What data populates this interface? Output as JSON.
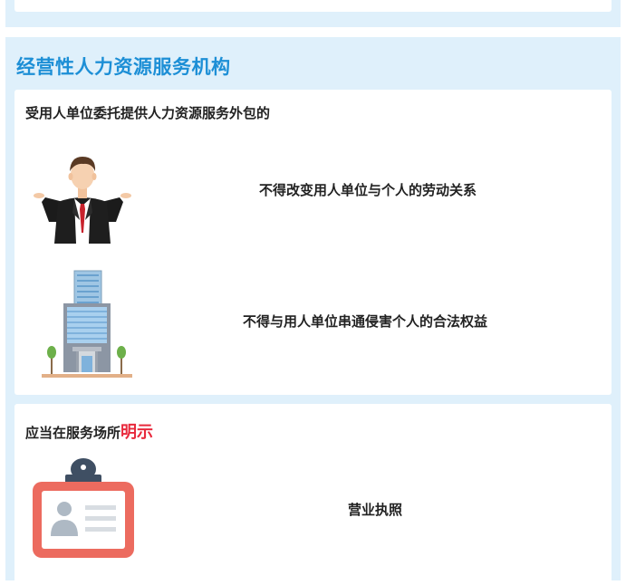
{
  "section": {
    "title": "经营性人力资源服务机构"
  },
  "card1": {
    "heading": "受用人单位委托提供人力资源服务外包的",
    "rows": [
      {
        "icon": "businessman-icon",
        "text": "不得改变用人单位与个人的劳动关系"
      },
      {
        "icon": "office-building-icon",
        "text": "不得与用人单位串通侵害个人的合法权益"
      }
    ]
  },
  "card2": {
    "heading_prefix": "应当在服务场所",
    "heading_highlight": "明示",
    "rows": [
      {
        "icon": "id-badge-icon",
        "text": "营业执照"
      }
    ]
  },
  "colors": {
    "section_bg": "#dff0fb",
    "title_blue": "#1d8fd6",
    "highlight_red": "#e8293c",
    "badge_red": "#ec6b5f"
  }
}
